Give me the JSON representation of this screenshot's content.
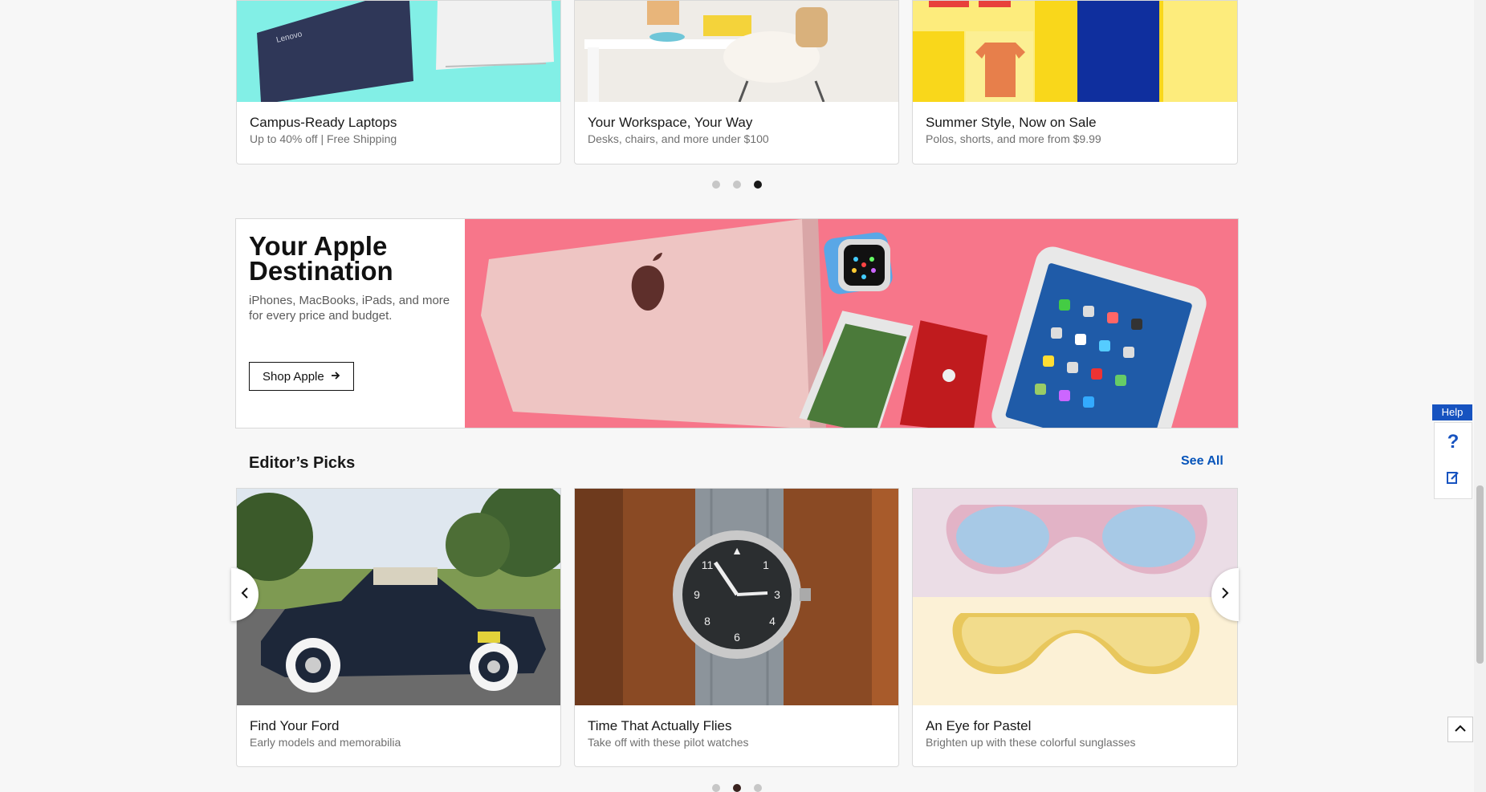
{
  "promo_cards": [
    {
      "title": "Campus-Ready Laptops",
      "subtitle": "Up to 40% off | Free Shipping",
      "image": "laptops-image"
    },
    {
      "title": "Your Workspace, Your Way",
      "subtitle": "Desks, chairs, and more under $100",
      "image": "workspace-image"
    },
    {
      "title": "Summer Style, Now on Sale",
      "subtitle": "Polos, shorts, and more from $9.99",
      "image": "summer-style-image"
    }
  ],
  "promo_carousel": {
    "page_count": 3,
    "active_index": 2
  },
  "apple_banner": {
    "title": "Your Apple Destination",
    "description": "iPhones, MacBooks, iPads, and more for every price and budget.",
    "button_label": "Shop Apple",
    "button_icon": "arrow-right-icon",
    "image": "apple-products-image",
    "background_color": "#f7768a"
  },
  "editors_picks": {
    "title": "Editor’s Picks",
    "see_all_label": "See All",
    "items": [
      {
        "title": "Find Your Ford",
        "subtitle": "Early models and memorabilia",
        "image": "vintage-ford-image"
      },
      {
        "title": "Time That Actually Flies",
        "subtitle": "Take off with these pilot watches",
        "image": "pilot-watch-image"
      },
      {
        "title": "An Eye for Pastel",
        "subtitle": "Brighten up with these colorful sunglasses",
        "image": "pastel-sunglasses-image"
      }
    ],
    "carousel": {
      "page_count": 3,
      "active_index": 1
    }
  },
  "help_widget": {
    "tab_label": "Help",
    "question_icon": "question-mark-icon",
    "feedback_icon": "feedback-icon"
  },
  "colors": {
    "link": "#0654ba",
    "help_blue": "#1753c0",
    "page_bg": "#f7f7f7"
  }
}
